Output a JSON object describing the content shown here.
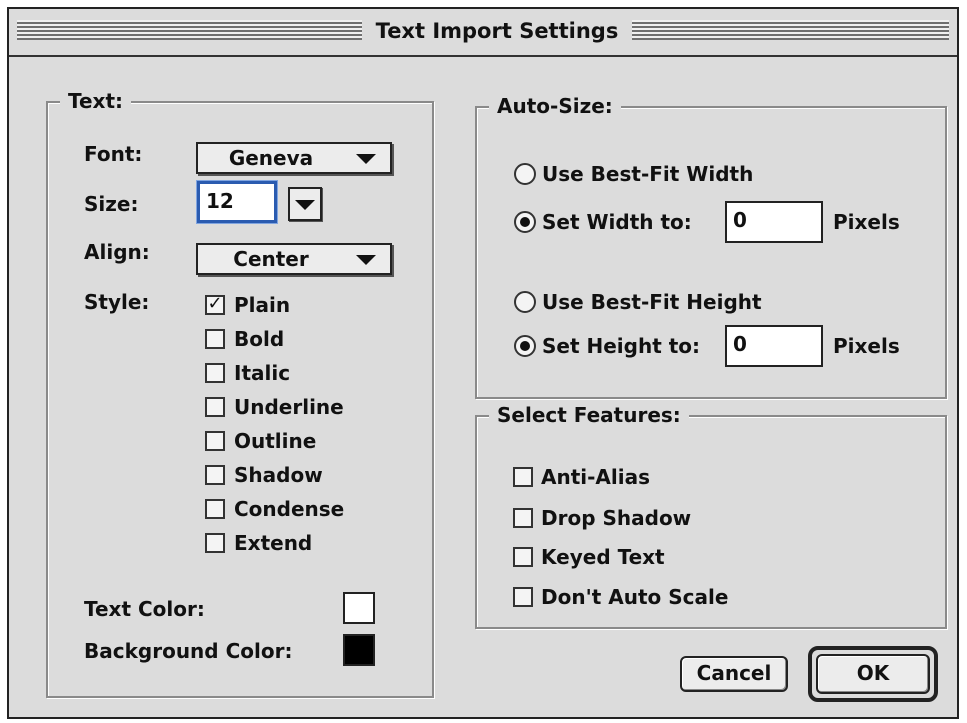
{
  "window": {
    "title": "Text Import Settings"
  },
  "text_group": {
    "title": "Text:",
    "font_label": "Font:",
    "font_value": "Geneva",
    "size_label": "Size:",
    "size_value": "12",
    "align_label": "Align:",
    "align_value": "Center",
    "style_label": "Style:",
    "styles": [
      {
        "label": "Plain",
        "checked": true
      },
      {
        "label": "Bold",
        "checked": false
      },
      {
        "label": "Italic",
        "checked": false
      },
      {
        "label": "Underline",
        "checked": false
      },
      {
        "label": "Outline",
        "checked": false
      },
      {
        "label": "Shadow",
        "checked": false
      },
      {
        "label": "Condense",
        "checked": false
      },
      {
        "label": "Extend",
        "checked": false
      }
    ],
    "text_color_label": "Text Color:",
    "text_color": "#ffffff",
    "background_color_label": "Background Color:",
    "background_color": "#000000"
  },
  "autosize_group": {
    "title": "Auto-Size:",
    "best_fit_width_label": "Use Best-Fit Width",
    "set_width_label": "Set Width to:",
    "width_value": "0",
    "width_unit": "Pixels",
    "best_fit_height_label": "Use Best-Fit Height",
    "set_height_label": "Set Height to:",
    "height_value": "0",
    "height_unit": "Pixels"
  },
  "features_group": {
    "title": "Select Features:",
    "items": [
      {
        "label": "Anti-Alias",
        "checked": false
      },
      {
        "label": "Drop Shadow",
        "checked": false
      },
      {
        "label": "Keyed Text",
        "checked": false
      },
      {
        "label": "Don't Auto Scale",
        "checked": false
      }
    ]
  },
  "buttons": {
    "cancel": "Cancel",
    "ok": "OK"
  },
  "icons": {
    "popup_arrow": "triangle-down-icon",
    "checkmark": "check-icon"
  }
}
